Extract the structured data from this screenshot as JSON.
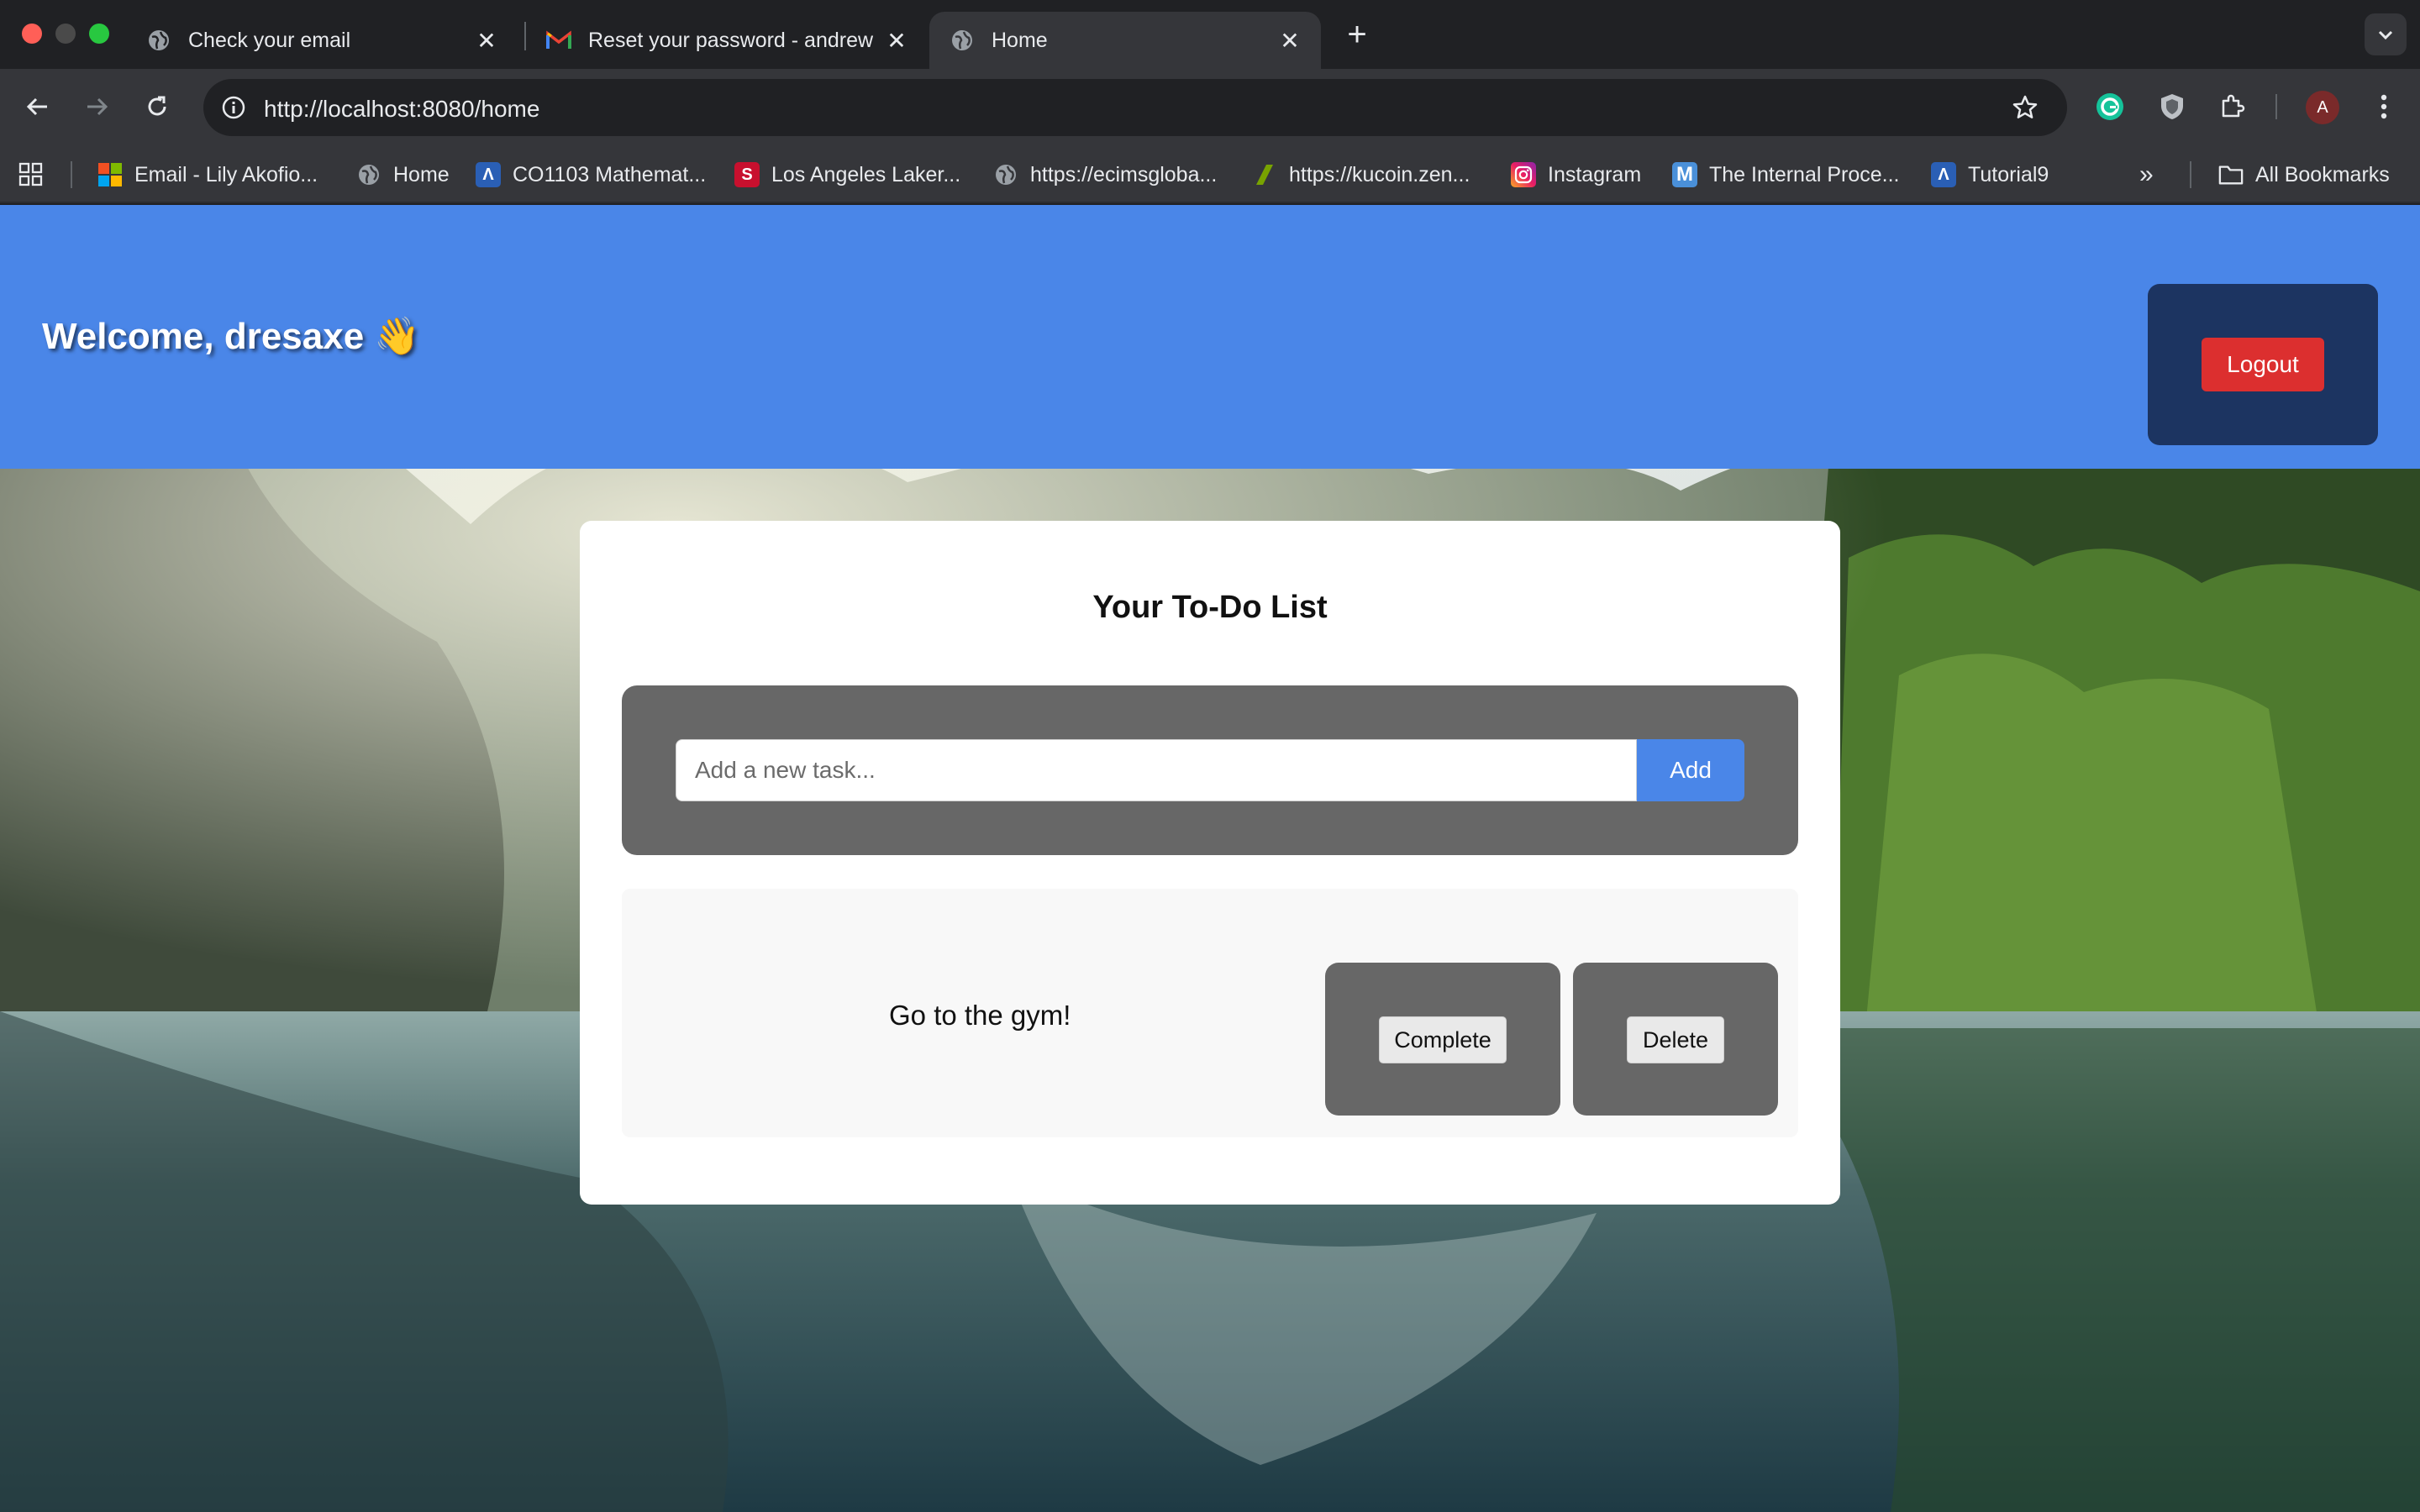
{
  "browser": {
    "tabs": [
      {
        "title": "Check your email",
        "icon": "globe-icon",
        "active": false
      },
      {
        "title": "Reset your password - andrew",
        "icon": "gmail-icon",
        "active": false
      },
      {
        "title": "Home",
        "icon": "globe-icon",
        "active": true
      }
    ],
    "url": "http://localhost:8080/home",
    "profile_initial": "A",
    "bookmarks": [
      {
        "label": "Email - Lily Akofio...",
        "icon": "microsoft-icon"
      },
      {
        "label": "Home",
        "icon": "globe-icon"
      },
      {
        "label": "CO1103 Mathemat...",
        "icon": "a-logo-icon"
      },
      {
        "label": "Los Angeles Laker...",
        "icon": "s-logo-icon"
      },
      {
        "label": "https://ecimsgloba...",
        "icon": "globe-icon"
      },
      {
        "label": "https://kucoin.zen...",
        "icon": "zendesk-icon"
      },
      {
        "label": "Instagram",
        "icon": "instagram-icon"
      },
      {
        "label": "The Internal Proce...",
        "icon": "m-logo-icon"
      },
      {
        "label": "Tutorial9",
        "icon": "a-logo-icon"
      }
    ],
    "all_bookmarks_label": "All Bookmarks"
  },
  "page": {
    "welcome": "Welcome, dresaxe 👋",
    "logout_label": "Logout",
    "card_title": "Your To-Do List",
    "input_placeholder": "Add a new task...",
    "input_value": "",
    "add_label": "Add",
    "todos": [
      {
        "text": "Go to the gym!",
        "complete_label": "Complete",
        "delete_label": "Delete"
      }
    ]
  },
  "colors": {
    "header": "#4a86e8",
    "logout_container": "#1c3461",
    "logout_button": "#dc2f2f",
    "add_button": "#4a86e8",
    "panel_gray": "#676767"
  }
}
